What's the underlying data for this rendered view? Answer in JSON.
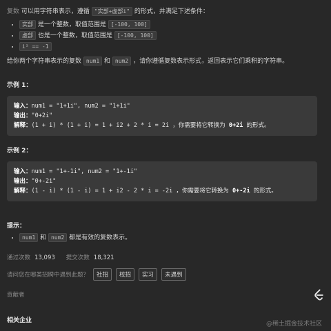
{
  "intro": {
    "w1": "复数",
    "w2": "可以用字符串表示，遵循",
    "format": "\"实部+虚部i\"",
    "w3": "的形式，并满足下述条件："
  },
  "conditions": [
    {
      "code": "实部",
      "text": "是一个整数，取值范围是",
      "range": "[-100, 100]"
    },
    {
      "code": "虚部",
      "text": "也是一个整数，取值范围是",
      "range": "[-100, 100]"
    },
    {
      "formula": "i² == -1"
    }
  ],
  "task": {
    "t1": "给你两个字符串表示的复数",
    "num1": "num1",
    "and": "和",
    "num2": "num2",
    "t2": "，请你遵循复数表示形式，返回表示它们乘积的字符串。"
  },
  "examples": [
    {
      "title": "示例 1：",
      "input_label": "输入：",
      "input": "num1 = \"1+1i\", num2 = \"1+1i\"",
      "output_label": "输出：",
      "output": "\"0+2i\"",
      "explain_label": "解释：",
      "explain_code": "(1 + i) * (1 + i) = 1 + i2 + 2 * i = 2i",
      "explain_text1": "，你需要将它转换为",
      "explain_bold": "0+2i",
      "explain_text2": "的形式。"
    },
    {
      "title": "示例 2：",
      "input_label": "输入：",
      "input": "num1 = \"1+-1i\", num2 = \"1+-1i\"",
      "output_label": "输出：",
      "output": "\"0+-2i\"",
      "explain_label": "解释：",
      "explain_code": "(1 - i) * (1 - i) = 1 + i2 - 2 * i = -2i",
      "explain_text1": "，你需要将它转换为",
      "explain_bold": "0+-2i",
      "explain_text2": "的形式。"
    }
  ],
  "hints": {
    "title": "提示：",
    "num1": "num1",
    "and": "和",
    "num2": "num2",
    "text": "都是有效的复数表示。"
  },
  "stats": {
    "pass_label": "通过次数",
    "pass_value": "13,093",
    "submit_label": "提交次数",
    "submit_value": "18,321"
  },
  "interview": {
    "question": "请问您在哪类招聘中遇到此题？",
    "tags": [
      "社招",
      "校招",
      "实习",
      "未遇到"
    ]
  },
  "contributors": "贡献者",
  "related": "相关企业",
  "watermark": "@稀土掘金技术社区",
  "colors": {
    "background": "#282828",
    "box": "#3a3a3a",
    "text": "#d4d4d4",
    "muted": "#8a8a8a"
  }
}
